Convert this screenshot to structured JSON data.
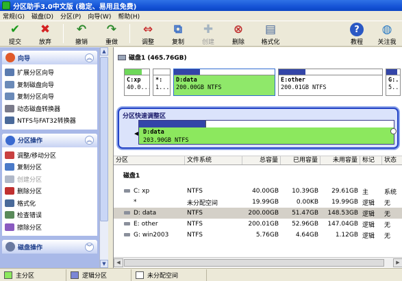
{
  "window": {
    "title": "分区助手3.0中文版 (稳定、易用且免费)"
  },
  "menu": [
    "常规(G)",
    "磁盘(D)",
    "分区(P)",
    "向导(W)",
    "帮助(H)"
  ],
  "toolbar": [
    {
      "label": "提交",
      "icon": "checkmark-icon",
      "color": "#1c9a1c",
      "glyph": "✔",
      "enabled": true
    },
    {
      "label": "放弃",
      "icon": "cross-icon",
      "color": "#d42222",
      "glyph": "✖",
      "enabled": true
    },
    {
      "label": "撤销",
      "icon": "undo-arrow-icon",
      "color": "#2d8a2d",
      "glyph": "↶",
      "enabled": true
    },
    {
      "label": "重做",
      "icon": "redo-arrow-icon",
      "color": "#2d8a2d",
      "glyph": "↷",
      "enabled": true
    },
    {
      "label": "调整",
      "icon": "resize-disk-icon",
      "color": "#c83030",
      "glyph": "⇔",
      "enabled": true
    },
    {
      "label": "复制",
      "icon": "copy-disk-icon",
      "color": "#3b6fc6",
      "glyph": "⧉",
      "enabled": true
    },
    {
      "label": "创建",
      "icon": "create-disk-icon",
      "color": "#6a8ab0",
      "glyph": "✚",
      "enabled": false
    },
    {
      "label": "删除",
      "icon": "delete-disk-icon",
      "color": "#c03030",
      "glyph": "⊗",
      "enabled": true
    },
    {
      "label": "格式化",
      "icon": "format-disk-icon",
      "color": "#4a6a9a",
      "glyph": "▤",
      "enabled": true
    },
    {
      "label": "教程",
      "icon": "help-icon",
      "color": "#2a58c4",
      "glyph": "?",
      "enabled": true
    },
    {
      "label": "关注我",
      "icon": "globe-icon",
      "color": "#2a7ac4",
      "glyph": "◍",
      "enabled": true
    }
  ],
  "sidebar": {
    "wizard": {
      "title": "向导",
      "items": [
        "扩展分区向导",
        "复制磁盘向导",
        "复制分区向导",
        "动态磁盘转换器",
        "NTFS与FAT32转换器"
      ]
    },
    "partition_ops": {
      "title": "分区操作",
      "items": [
        {
          "label": "调整/移动分区",
          "enabled": true
        },
        {
          "label": "复制分区",
          "enabled": true
        },
        {
          "label": "创建分区",
          "enabled": false
        },
        {
          "label": "删除分区",
          "enabled": true
        },
        {
          "label": "格式化",
          "enabled": true
        },
        {
          "label": "检查错误",
          "enabled": true
        },
        {
          "label": "擦除分区",
          "enabled": true
        }
      ]
    },
    "disk_ops": {
      "title": "磁盘操作"
    }
  },
  "disk": {
    "header": "磁盘1 (465.76GB)",
    "partitions": [
      {
        "label": "C:xp",
        "size": "40.0...",
        "bar_color": "#6ed85a",
        "usage_fraction": 0.26,
        "selected": false
      },
      {
        "label": "*:",
        "size": "1...",
        "bar_color": "#ffffff",
        "usage_fraction": 0.0,
        "selected": false
      },
      {
        "label": "D:data",
        "size": "200.00GB NTFS",
        "bar_color": "#3345a8",
        "usage_fraction": 0.26,
        "selected": true
      },
      {
        "label": "E:other",
        "size": "200.01GB NTFS",
        "bar_color": "#3345a8",
        "usage_fraction": 0.26,
        "selected": false
      },
      {
        "label": "G:...",
        "size": "5...",
        "bar_color": "#3345a8",
        "usage_fraction": 0.8,
        "selected": false
      }
    ]
  },
  "quick_resize": {
    "title": "分区快速调整区",
    "label": "D:data",
    "size": "203.90GB NTFS",
    "usage_fraction": 0.26,
    "free_fraction": 0.02
  },
  "table": {
    "headers": [
      "分区",
      "文件系统",
      "总容量",
      "已用容量",
      "未用容量",
      "标记",
      "状态"
    ],
    "disk_label": "磁盘1",
    "rows": [
      {
        "name": "C:  xp",
        "fs": "NTFS",
        "total": "40.00GB",
        "used": "10.39GB",
        "free": "29.61GB",
        "flag": "主",
        "status": "系统",
        "selected": false,
        "icon": true
      },
      {
        "name": "*",
        "fs": "未分配空间",
        "total": "19.99GB",
        "used": "0.00KB",
        "free": "19.99GB",
        "flag": "逻辑",
        "status": "无",
        "selected": false,
        "icon": false
      },
      {
        "name": "D:  data",
        "fs": "NTFS",
        "total": "200.00GB",
        "used": "51.47GB",
        "free": "148.53GB",
        "flag": "逻辑",
        "status": "无",
        "selected": true,
        "icon": true
      },
      {
        "name": "E:  other",
        "fs": "NTFS",
        "total": "200.01GB",
        "used": "52.96GB",
        "free": "147.04GB",
        "flag": "逻辑",
        "status": "无",
        "selected": false,
        "icon": true
      },
      {
        "name": "G:  win2003",
        "fs": "NTFS",
        "total": "5.76GB",
        "used": "4.64GB",
        "free": "1.12GB",
        "flag": "逻辑",
        "status": "无",
        "selected": false,
        "icon": true
      }
    ]
  },
  "legend": [
    {
      "label": "主分区",
      "color": "#8ce85e"
    },
    {
      "label": "逻辑分区",
      "color": "#7b86d6"
    },
    {
      "label": "未分配空间",
      "color": "#ffffff"
    }
  ]
}
